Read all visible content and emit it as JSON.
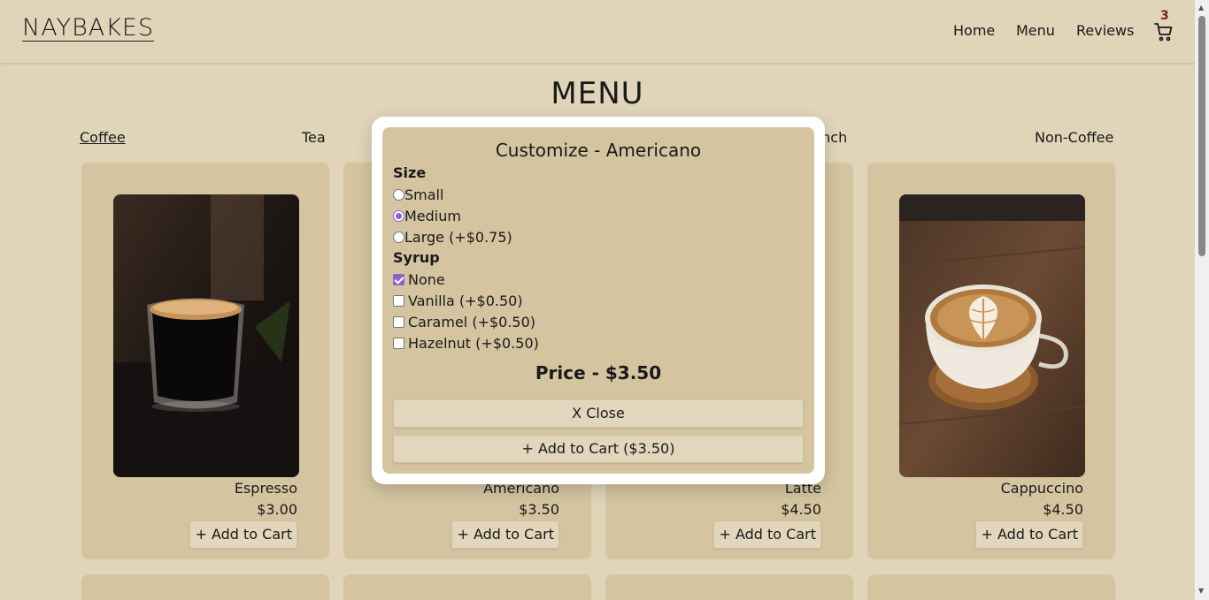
{
  "brand": {
    "logo": "NAYBAKES"
  },
  "nav": {
    "home": "Home",
    "menu": "Menu",
    "reviews": "Reviews",
    "cart_count": "3"
  },
  "page": {
    "title": "MENU"
  },
  "categories": {
    "coffee": "Coffee",
    "tea": "Tea",
    "brunch": "unch",
    "noncoffee": "Non-Coffee"
  },
  "products": [
    {
      "name": "Espresso",
      "price": "$3.00",
      "button": "+ Add to Cart"
    },
    {
      "name": "Americano",
      "price": "$3.50",
      "button": "+ Add to Cart"
    },
    {
      "name": "Latte",
      "price": "$4.50",
      "button": "+ Add to Cart"
    },
    {
      "name": "Cappuccino",
      "price": "$4.50",
      "button": "+ Add to Cart"
    }
  ],
  "modal": {
    "title": "Customize - Americano",
    "size_label": "Size",
    "sizes": [
      {
        "label": "Small",
        "checked": false
      },
      {
        "label": "Medium",
        "checked": true
      },
      {
        "label": "Large (+$0.75)",
        "checked": false
      }
    ],
    "syrup_label": "Syrup",
    "syrups": [
      {
        "label": "None",
        "checked": true
      },
      {
        "label": "Vanilla (+$0.50)",
        "checked": false
      },
      {
        "label": "Caramel (+$0.50)",
        "checked": false
      },
      {
        "label": "Hazelnut (+$0.50)",
        "checked": false
      }
    ],
    "price": "Price - $3.50",
    "close_button": "X Close",
    "add_button": "+ Add to Cart ($3.50)"
  },
  "colors": {
    "background": "#e0d4b9",
    "card": "#d4c5a0",
    "accent": "#8a63d2",
    "cart_badge": "#7a1e1e"
  }
}
